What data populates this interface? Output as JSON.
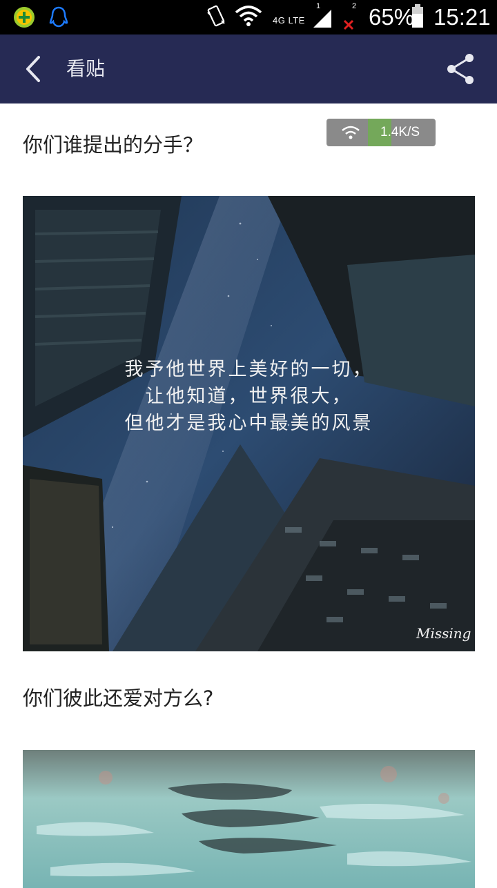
{
  "status_bar": {
    "network_label": "4G LTE",
    "sim1_label": "1",
    "sim2_label": "2",
    "battery_percent": "65%",
    "time": "15:21",
    "icons": [
      "add-app-icon",
      "qq-penguin-icon",
      "vibrate-icon",
      "wifi-icon",
      "signal-icon",
      "battery-icon"
    ]
  },
  "top_bar": {
    "title": "看贴",
    "back_icon": "back-arrow-icon",
    "share_icon": "share-icon"
  },
  "speed_indicator": {
    "text": "1.4K/S"
  },
  "posts": [
    {
      "question": "你们谁提出的分手？",
      "image_quote": [
        "我予他世界上美好的一切，",
        "让他知道，世界很大，",
        "但他才是我心中最美的风景"
      ],
      "image_signature": "Missing"
    },
    {
      "question": "你们彼此还爱对方么?"
    }
  ],
  "colors": {
    "status_bar_bg": "#000000",
    "top_bar_bg": "#262a54",
    "speed_fill": "#74a85a"
  }
}
